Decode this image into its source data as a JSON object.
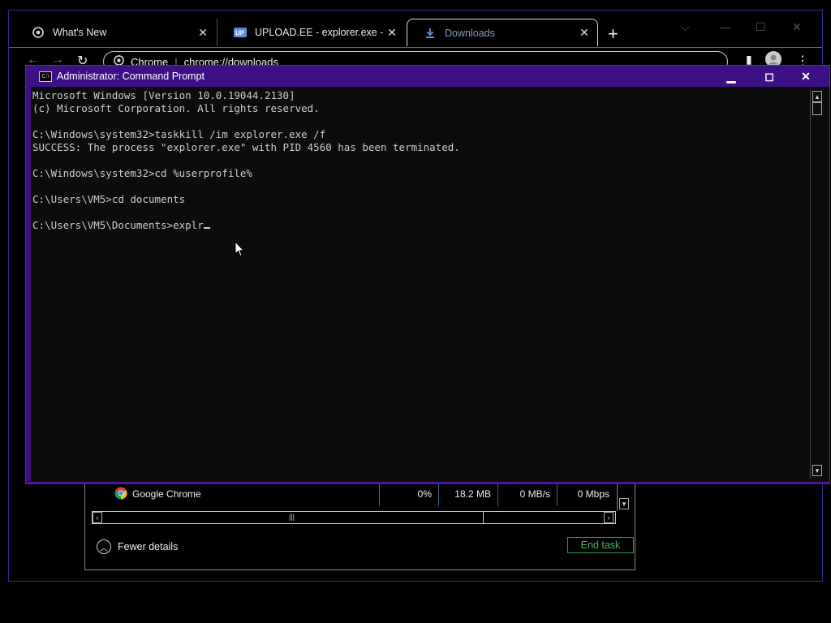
{
  "browser": {
    "tabs": [
      {
        "label": "What's New",
        "icon": "chrome-icon"
      },
      {
        "label": "UPLOAD.EE - explorer.exe - Dow",
        "icon": "upload-ee-icon"
      },
      {
        "label": "Downloads",
        "icon": "download-icon"
      }
    ],
    "omnibox": {
      "site": "Chrome",
      "url": "chrome://downloads"
    }
  },
  "taskmanager": {
    "row": {
      "name": "Google Chrome",
      "cpu": "0%",
      "memory": "18.2 MB",
      "disk": "0 MB/s",
      "network": "0 Mbps"
    },
    "fewer_details": "Fewer details",
    "end_task": "End task"
  },
  "cmd": {
    "title": "Administrator: Command Prompt",
    "lines": [
      "Microsoft Windows [Version 10.0.19044.2130]",
      "(c) Microsoft Corporation. All rights reserved.",
      "",
      "C:\\Windows\\system32>taskkill /im explorer.exe /f",
      "SUCCESS: The process \"explorer.exe\" with PID 4560 has been terminated.",
      "",
      "C:\\Windows\\system32>cd %userprofile%",
      "",
      "C:\\Users\\VM5>cd documents",
      ""
    ],
    "current_line": "C:\\Users\\VM5\\Documents>explr"
  },
  "colors": {
    "cmd_title_bg": "#3d1085",
    "end_task": "#3fb950"
  }
}
